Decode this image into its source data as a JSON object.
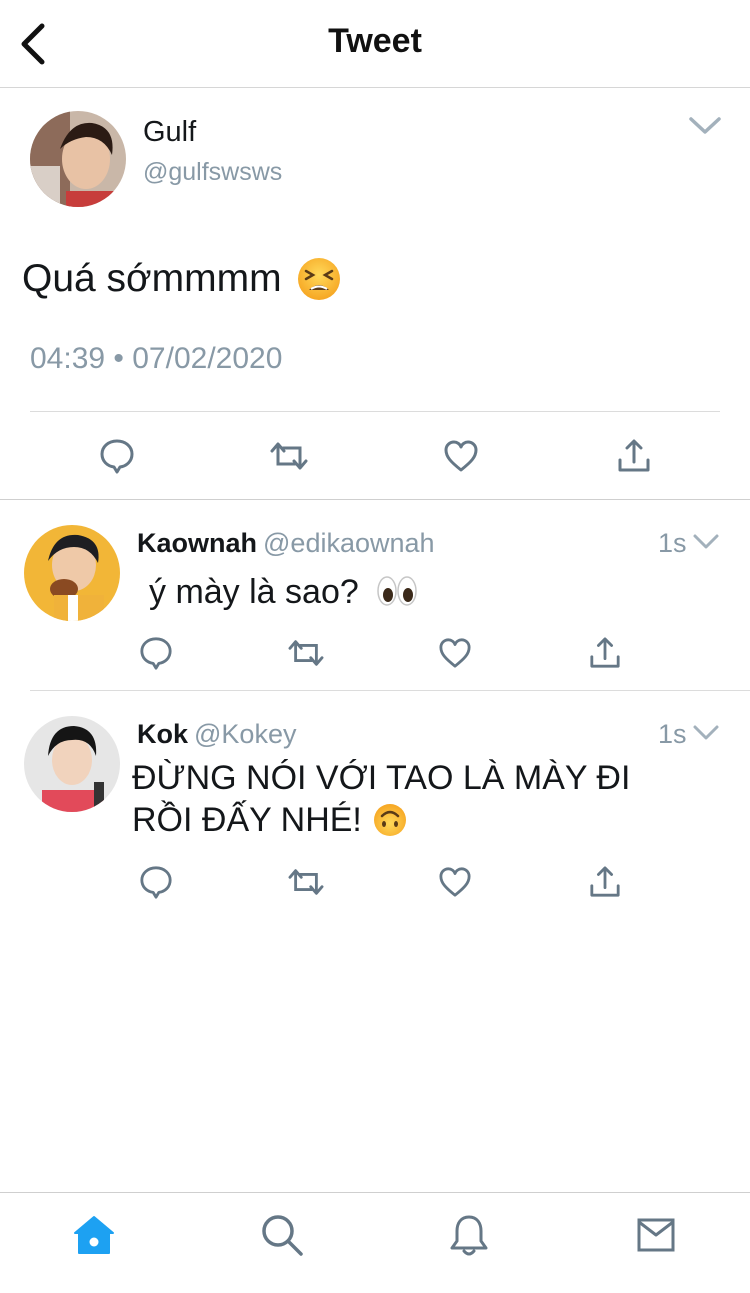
{
  "header": {
    "title": "Tweet"
  },
  "main_tweet": {
    "name": "Gulf",
    "handle": "@gulfswsws",
    "text": "Quá sớmmmm",
    "emoji": "tired-face",
    "timestamp": "04:39 • 07/02/2020"
  },
  "replies": [
    {
      "name": "Kaownah",
      "handle": "@edikaownah",
      "time": "1s",
      "text": "ý mày là sao?",
      "emoji": "eyes"
    },
    {
      "name": "Kok",
      "handle": "@Kokey",
      "time": "1s",
      "text_line1": "ĐỪNG NÓI VỚI TAO LÀ MÀY ĐI",
      "text_line2": "RỒI ĐẤY NHÉ!",
      "emoji": "upside-down-face"
    }
  ],
  "colors": {
    "accent": "#1da1f2",
    "secondary_text": "#8899a6",
    "icon_gray": "#657786"
  },
  "bottom_nav": [
    "home",
    "search",
    "notifications",
    "messages"
  ]
}
